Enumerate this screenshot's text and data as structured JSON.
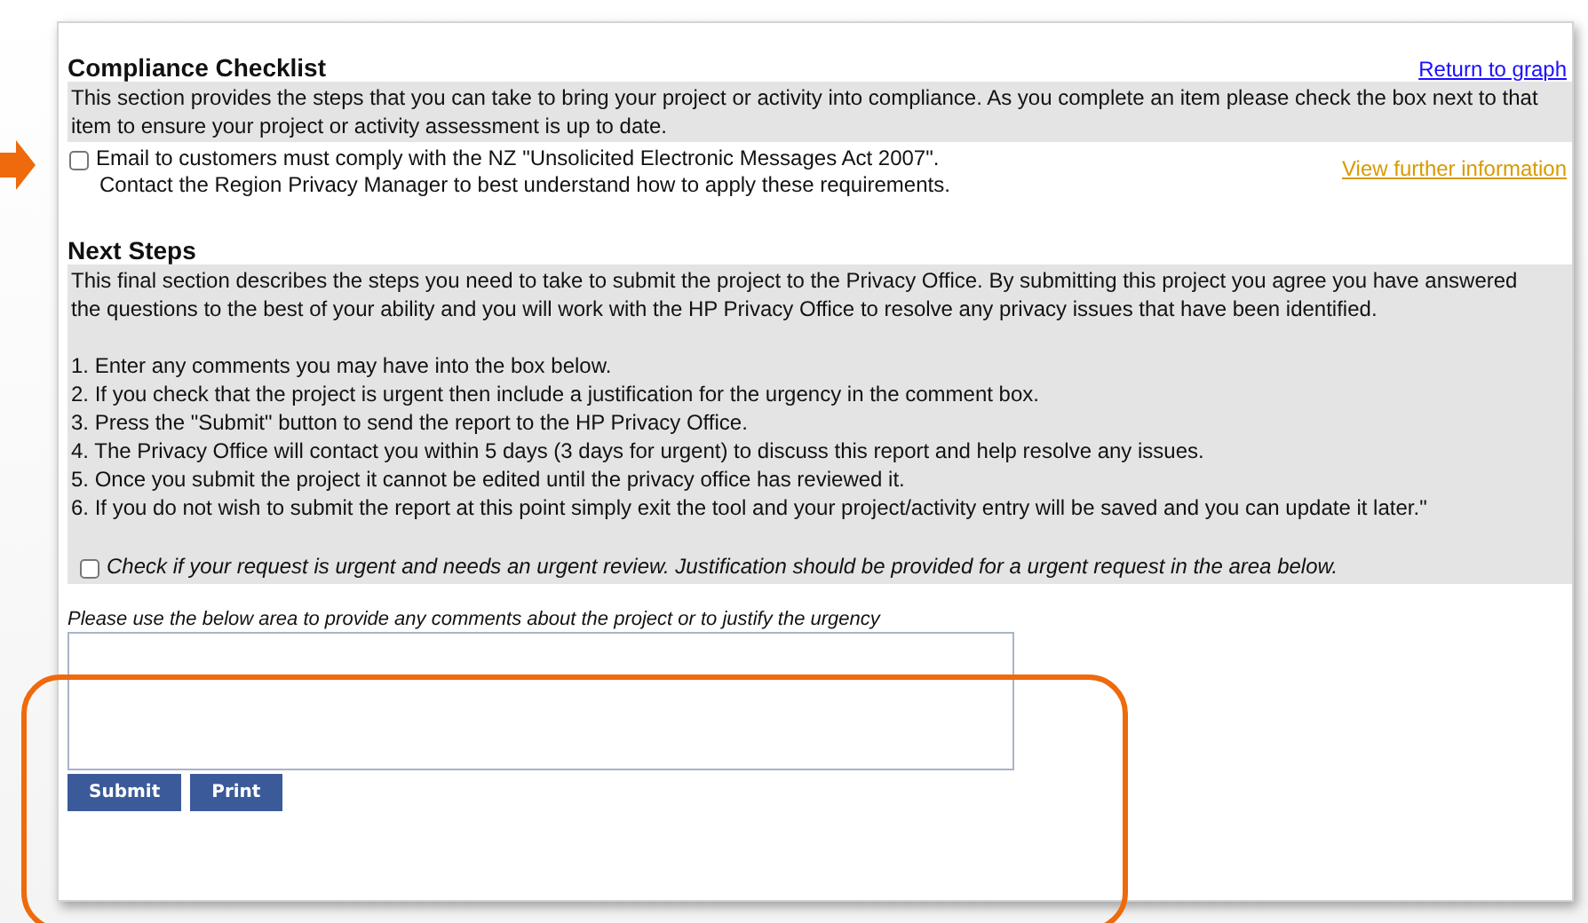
{
  "compliance": {
    "title": "Compliance Checklist",
    "return_link": "Return to graph",
    "description": "This section provides the steps that you can take to bring your project or activity into compliance. As you complete an item please check the box next to that item to ensure your project or activity assessment is up to date.",
    "items": [
      {
        "lines": [
          "Email to customers must comply with the NZ \"Unsolicited Electronic Messages Act 2007\".",
          "Contact the Region Privacy Manager to best understand how to apply these requirements."
        ],
        "checked": false,
        "link": "View further information"
      }
    ]
  },
  "next_steps": {
    "title": "Next Steps",
    "intro": "This final section describes the steps you need to take to submit the project to the Privacy Office. By submitting this project you agree you have answered the questions to the best of your ability and you will work with the HP Privacy Office to resolve any privacy issues that have been identified.",
    "steps": [
      "1. Enter any comments you may have into the box below.",
      "2. If you check that the project is urgent then include a justification for the urgency in the comment box.",
      "3. Press the \"Submit\" button to send the report to the HP Privacy Office.",
      "4. The Privacy Office will contact you within 5 days (3 days for urgent) to discuss this report and help resolve any issues.",
      "5. Once you submit the project it cannot be edited until the privacy office has reviewed it.",
      "6. If you do not wish to submit the report at this point simply exit the tool and your project/activity entry will be saved and you can update it later.\""
    ],
    "urgent": {
      "label": "Check if your request is urgent and needs an urgent review. Justification should be provided for a urgent request in the area below.",
      "checked": false
    }
  },
  "comments": {
    "label": "Please use the below area to provide any comments about the project or to justify the urgency",
    "buttons": [
      "Submit",
      "Print"
    ]
  }
}
